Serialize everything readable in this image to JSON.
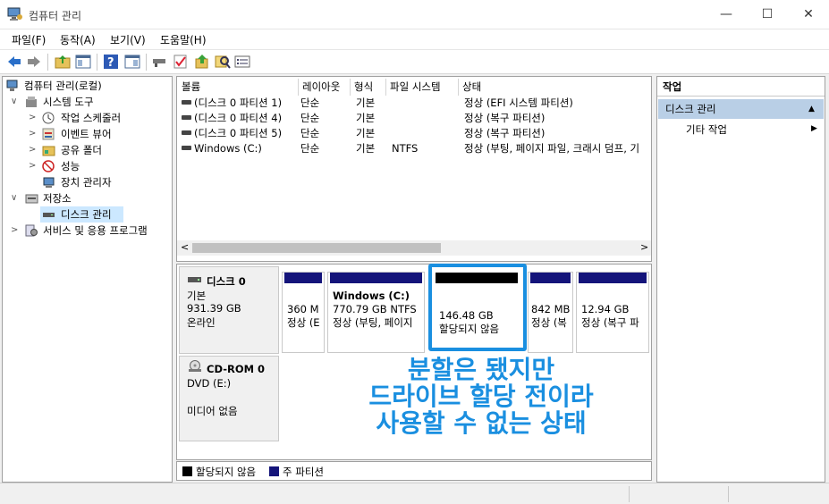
{
  "window": {
    "title": "컴퓨터 관리",
    "minimize": "—",
    "maximize": "☐",
    "close": "✕"
  },
  "menu": [
    "파일(F)",
    "동작(A)",
    "보기(V)",
    "도움말(H)"
  ],
  "tree": {
    "root": "컴퓨터 관리(로컬)",
    "items": [
      {
        "label": "시스템 도구",
        "chev": "∨"
      },
      {
        "label": "작업 스케줄러",
        "chev": ">"
      },
      {
        "label": "이벤트 뷰어",
        "chev": ">"
      },
      {
        "label": "공유 폴더",
        "chev": ">"
      },
      {
        "label": "성능",
        "chev": ">"
      },
      {
        "label": "장치 관리자",
        "chev": ""
      },
      {
        "label": "저장소",
        "chev": "∨"
      },
      {
        "label": "디스크 관리",
        "chev": ""
      },
      {
        "label": "서비스 및 응용 프로그램",
        "chev": ">"
      }
    ]
  },
  "volume_list": {
    "columns": [
      "볼륨",
      "레이아웃",
      "형식",
      "파일 시스템",
      "상태"
    ],
    "rows": [
      {
        "volume": "(디스크 0 파티션 1)",
        "layout": "단순",
        "type": "기본",
        "fs": "",
        "status": "정상 (EFI 시스템 파티션)"
      },
      {
        "volume": "(디스크 0 파티션 4)",
        "layout": "단순",
        "type": "기본",
        "fs": "",
        "status": "정상 (복구 파티션)"
      },
      {
        "volume": "(디스크 0 파티션 5)",
        "layout": "단순",
        "type": "기본",
        "fs": "",
        "status": "정상 (복구 파티션)"
      },
      {
        "volume": "Windows (C:)",
        "layout": "단순",
        "type": "기본",
        "fs": "NTFS",
        "status": "정상 (부팅, 페이지 파일, 크래시 덤프, 기"
      }
    ],
    "scroll_left": "<",
    "scroll_right": ">"
  },
  "disk0": {
    "name": "디스크 0",
    "kind": "기본",
    "size": "931.39 GB",
    "state": "온라인",
    "partitions": [
      {
        "line1": "",
        "line2": "360 M",
        "line3": "정상 (E"
      },
      {
        "line1": "Windows  (C:)",
        "line2": "770.79 GB NTFS",
        "line3": "정상 (부팅, 페이지"
      },
      {
        "line1": "",
        "line2": "146.48 GB",
        "line3": "할당되지 않음"
      },
      {
        "line1": "",
        "line2": "842 MB",
        "line3": "정상 (복"
      },
      {
        "line1": "",
        "line2": "12.94 GB",
        "line3": "정상 (복구 파"
      }
    ]
  },
  "cdrom0": {
    "name": "CD-ROM 0",
    "drive": "DVD (E:)",
    "state": "미디어 없음"
  },
  "legend": {
    "unallocated": "할당되지 않음",
    "primary": "주 파티션"
  },
  "actions": {
    "header": "작업",
    "selected": "디스크 관리",
    "selected_arrow": "▲",
    "item": "기타 작업",
    "item_arrow": "▶"
  },
  "annotation": {
    "line1": "분할은 됐지만",
    "line2": "드라이브 할당 전이라",
    "line3": "사용할 수 없는 상태"
  },
  "colors": {
    "primary_partition": "#14147a",
    "unallocated": "#000000",
    "annotation": "#1a8fe0"
  }
}
